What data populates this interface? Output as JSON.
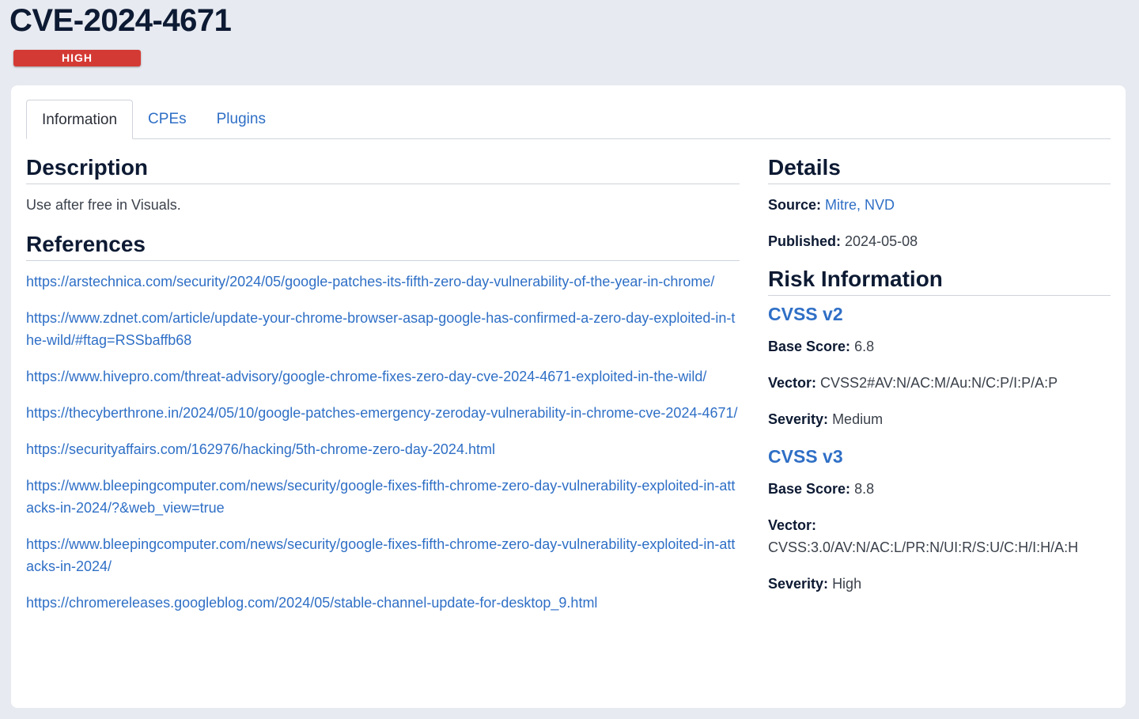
{
  "header": {
    "title": "CVE-2024-4671",
    "severity": "HIGH"
  },
  "tabs": [
    {
      "label": "Information",
      "active": true
    },
    {
      "label": "CPEs",
      "active": false
    },
    {
      "label": "Plugins",
      "active": false
    }
  ],
  "description": {
    "heading": "Description",
    "text": "Use after free in Visuals."
  },
  "references": {
    "heading": "References",
    "links": [
      "https://arstechnica.com/security/2024/05/google-patches-its-fifth-zero-day-vulnerability-of-the-year-in-chrome/",
      "https://www.zdnet.com/article/update-your-chrome-browser-asap-google-has-confirmed-a-zero-day-exploited-in-the-wild/#ftag=RSSbaffb68",
      "https://www.hivepro.com/threat-advisory/google-chrome-fixes-zero-day-cve-2024-4671-exploited-in-the-wild/",
      "https://thecyberthrone.in/2024/05/10/google-patches-emergency-zeroday-vulnerability-in-chrome-cve-2024-4671/",
      "https://securityaffairs.com/162976/hacking/5th-chrome-zero-day-2024.html",
      "https://www.bleepingcomputer.com/news/security/google-fixes-fifth-chrome-zero-day-vulnerability-exploited-in-attacks-in-2024/?&web_view=true",
      "https://www.bleepingcomputer.com/news/security/google-fixes-fifth-chrome-zero-day-vulnerability-exploited-in-attacks-in-2024/",
      "https://chromereleases.googleblog.com/2024/05/stable-channel-update-for-desktop_9.html"
    ]
  },
  "details": {
    "heading": "Details",
    "source_label": "Source:",
    "source_value": "Mitre, NVD",
    "published_label": "Published:",
    "published_value": "2024-05-08"
  },
  "risk": {
    "heading": "Risk Information",
    "base_score_label": "Base Score:",
    "vector_label": "Vector:",
    "severity_label": "Severity:",
    "cvss_v2": {
      "heading": "CVSS v2",
      "base_score": "6.8",
      "vector": "CVSS2#AV:N/AC:M/Au:N/C:P/I:P/A:P",
      "severity": "Medium"
    },
    "cvss_v3": {
      "heading": "CVSS v3",
      "base_score": "8.8",
      "vector": "CVSS:3.0/AV:N/AC:L/PR:N/UI:R/S:U/C:H/I:H/A:H",
      "severity": "High"
    }
  },
  "colors": {
    "severity_badge": "#d43a34",
    "link": "#2f6fc6",
    "heading": "#0d1a33",
    "background": "#e7eaf0"
  }
}
